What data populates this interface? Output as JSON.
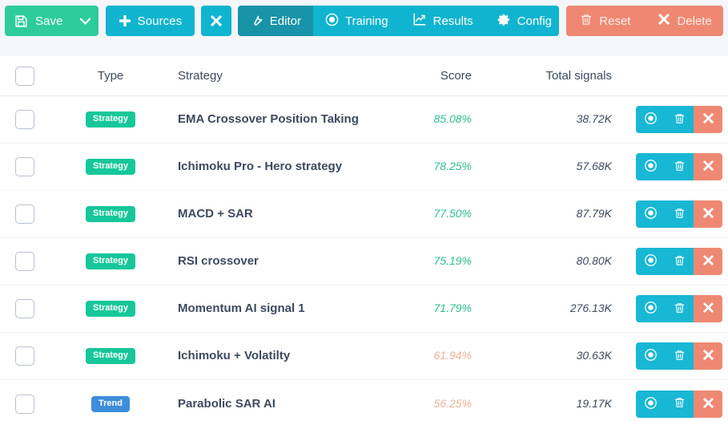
{
  "toolbar": {
    "save": {
      "label": "Save",
      "icon": "floppy-disk-icon",
      "caret": "chevron-down-icon",
      "color": "#2ecc9a"
    },
    "sources": {
      "label": "Sources",
      "icon": "plus-icon",
      "color": "#11b4cf"
    },
    "close": {
      "label": "",
      "icon": "close-x-icon",
      "color": "#11b4cf"
    },
    "tabs": [
      {
        "label": "Editor",
        "icon": "wrench-icon",
        "active": true,
        "color": "#1993a8"
      },
      {
        "label": "Training",
        "icon": "record-circle-icon",
        "active": false,
        "color": "#11b4cf"
      },
      {
        "label": "Results",
        "icon": "line-chart-icon",
        "active": false,
        "color": "#11b4cf"
      },
      {
        "label": "Config",
        "icon": "gear-icon",
        "active": false,
        "color": "#11b4cf"
      }
    ],
    "danger": [
      {
        "label": "Reset",
        "icon": "trash-icon",
        "color": "#ef8872"
      },
      {
        "label": "Delete",
        "icon": "close-x-icon",
        "color": "#ef8872"
      }
    ]
  },
  "table": {
    "columns": {
      "select": "",
      "type": "Type",
      "strategy": "Strategy",
      "score": "Score",
      "signals": "Total signals"
    },
    "row_actions": [
      {
        "name": "record-circle-icon",
        "color": "#18b7d4"
      },
      {
        "name": "trash-icon",
        "color": "#18b7d4"
      },
      {
        "name": "close-x-icon",
        "color": "#ef8872"
      }
    ],
    "rows": [
      {
        "checked": false,
        "type": "Strategy",
        "type_color": "#16c79a",
        "strategy": "EMA Crossover Position Taking",
        "score": "85.08%",
        "score_state": "good",
        "signals": "38.72K"
      },
      {
        "checked": false,
        "type": "Strategy",
        "type_color": "#16c79a",
        "strategy": "Ichimoku Pro - Hero strategy",
        "score": "78.25%",
        "score_state": "good",
        "signals": "57.68K"
      },
      {
        "checked": false,
        "type": "Strategy",
        "type_color": "#16c79a",
        "strategy": "MACD + SAR",
        "score": "77.50%",
        "score_state": "good",
        "signals": "87.79K"
      },
      {
        "checked": false,
        "type": "Strategy",
        "type_color": "#16c79a",
        "strategy": "RSI crossover",
        "score": "75.19%",
        "score_state": "good",
        "signals": "80.80K"
      },
      {
        "checked": false,
        "type": "Strategy",
        "type_color": "#16c79a",
        "strategy": "Momentum AI signal 1",
        "score": "71.79%",
        "score_state": "good",
        "signals": "276.13K"
      },
      {
        "checked": false,
        "type": "Strategy",
        "type_color": "#16c79a",
        "strategy": "Ichimoku + Volatilty",
        "score": "61.94%",
        "score_state": "warn",
        "signals": "30.63K"
      },
      {
        "checked": false,
        "type": "Trend",
        "type_color": "#3d8ddb",
        "strategy": "Parabolic SAR AI",
        "score": "56.25%",
        "score_state": "warn",
        "signals": "19.17K"
      }
    ]
  },
  "colors": {
    "page_background": "#f4f6fa",
    "card_background": "#ffffff",
    "text_primary": "#3c4a5e",
    "accent_cyan": "#11b4cf",
    "accent_green": "#2ecc9a",
    "accent_salmon": "#ef8872",
    "score_good": "#2fc08b",
    "score_warn": "#e8b396"
  }
}
